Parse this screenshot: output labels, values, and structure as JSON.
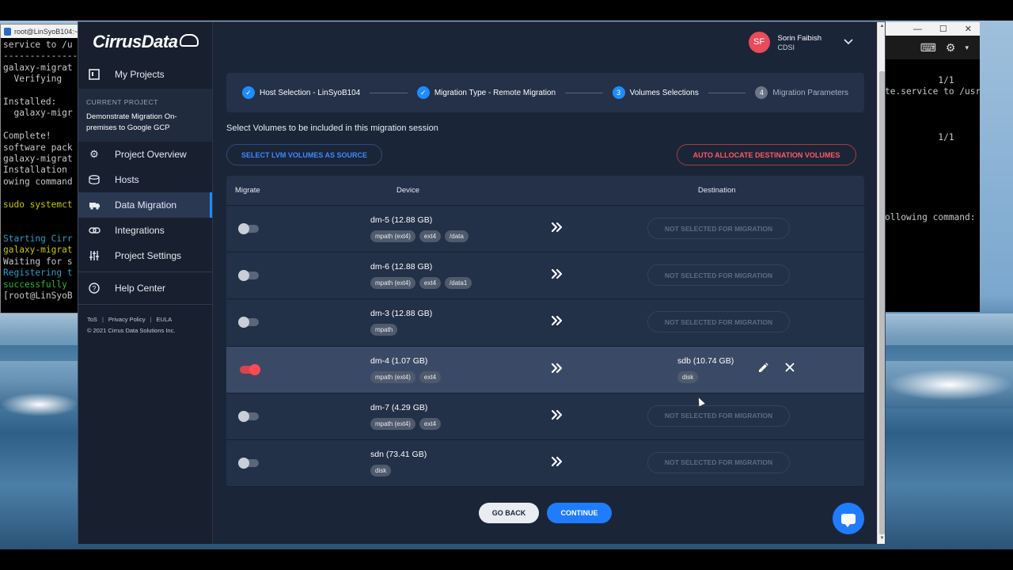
{
  "terminal_left": {
    "title": "root@LinSyoB104:~",
    "lines": [
      "service to /u",
      "--------------",
      "galaxy-migrat",
      "  Verifying",
      "",
      "Installed:",
      "  galaxy-migr",
      "",
      "Complete!",
      "software pack",
      "galaxy-migrat",
      "Installation",
      "owing command",
      "",
      "sudo systemct",
      "",
      "",
      "Starting Cirr",
      "galaxy-migrat",
      "Waiting for s",
      "Registering t",
      "successfully",
      "[root@LinSyoB"
    ]
  },
  "terminal_right": {
    "lines": [
      {
        "text": "          1/1",
        "top_line": 0
      },
      {
        "text": "te.service to /usr",
        "top_line": 1
      },
      {
        "text": "          1/1",
        "top_line": 5
      },
      {
        "text": "ollowing command:",
        "top_line": 12
      }
    ]
  },
  "sidebar": {
    "logo": "CirrusData",
    "my_projects": "My Projects",
    "current_project_label": "CURRENT PROJECT",
    "current_project_name": "Demonstrate Migration On-premises to Google GCP",
    "items": [
      {
        "label": "Project Overview",
        "icon": "gear-icon"
      },
      {
        "label": "Hosts",
        "icon": "hosts-icon"
      },
      {
        "label": "Data Migration",
        "icon": "migration-icon"
      },
      {
        "label": "Integrations",
        "icon": "link-icon"
      },
      {
        "label": "Project Settings",
        "icon": "sliders-icon"
      }
    ],
    "help": "Help Center",
    "footer_links": [
      "ToS",
      "Privacy Policy",
      "EULA"
    ],
    "copyright": "© 2021 Cirrus Data Solutions Inc."
  },
  "header": {
    "avatar_initials": "SF",
    "user_name": "Sorin Faibish",
    "user_org": "CDSI",
    "avatar_color": "#e84b5a"
  },
  "stepper": {
    "steps": [
      {
        "label": "Host Selection - LinSyoB104",
        "marker": "✓",
        "state": "done"
      },
      {
        "label": "Migration Type - Remote Migration",
        "marker": "✓",
        "state": "done"
      },
      {
        "label": "Volumes Selections",
        "marker": "3",
        "state": "current"
      },
      {
        "label": "Migration Parameters",
        "marker": "4",
        "state": "pending"
      }
    ]
  },
  "intro_text": "Select Volumes to be included in this migration session",
  "actions": {
    "select_lvm": "SELECT LVM VOLUMES AS SOURCE",
    "auto_allocate": "AUTO ALLOCATE DESTINATION VOLUMES"
  },
  "table": {
    "headers": {
      "migrate": "Migrate",
      "device": "Device",
      "destination": "Destination"
    },
    "rows": [
      {
        "enabled": false,
        "device": "dm-5 (12.88 GB)",
        "tags": [
          "mpath (ext4)",
          "ext4",
          "/data"
        ],
        "destination": "NOT SELECTED FOR MIGRATION"
      },
      {
        "enabled": false,
        "device": "dm-6 (12.88 GB)",
        "tags": [
          "mpath (ext4)",
          "ext4",
          "/data1"
        ],
        "destination": "NOT SELECTED FOR MIGRATION"
      },
      {
        "enabled": false,
        "device": "dm-3 (12.88 GB)",
        "tags": [
          "mpath"
        ],
        "destination": "NOT SELECTED FOR MIGRATION"
      },
      {
        "enabled": true,
        "device": "dm-4 (1.07 GB)",
        "tags": [
          "mpath (ext4)",
          "ext4"
        ],
        "destination_volume": "sdb (10.74 GB)",
        "destination_tags": [
          "disk"
        ]
      },
      {
        "enabled": false,
        "device": "dm-7 (4.29 GB)",
        "tags": [
          "mpath (ext4)",
          "ext4"
        ],
        "destination": "NOT SELECTED FOR MIGRATION"
      },
      {
        "enabled": false,
        "device": "sdn (73.41 GB)",
        "tags": [
          "disk"
        ],
        "destination": "NOT SELECTED FOR MIGRATION"
      }
    ]
  },
  "footer_buttons": {
    "back": "GO BACK",
    "continue": "CONTINUE"
  },
  "colors": {
    "accent": "#1f7cff",
    "danger": "#ff4a55",
    "background": "#1b2538"
  }
}
